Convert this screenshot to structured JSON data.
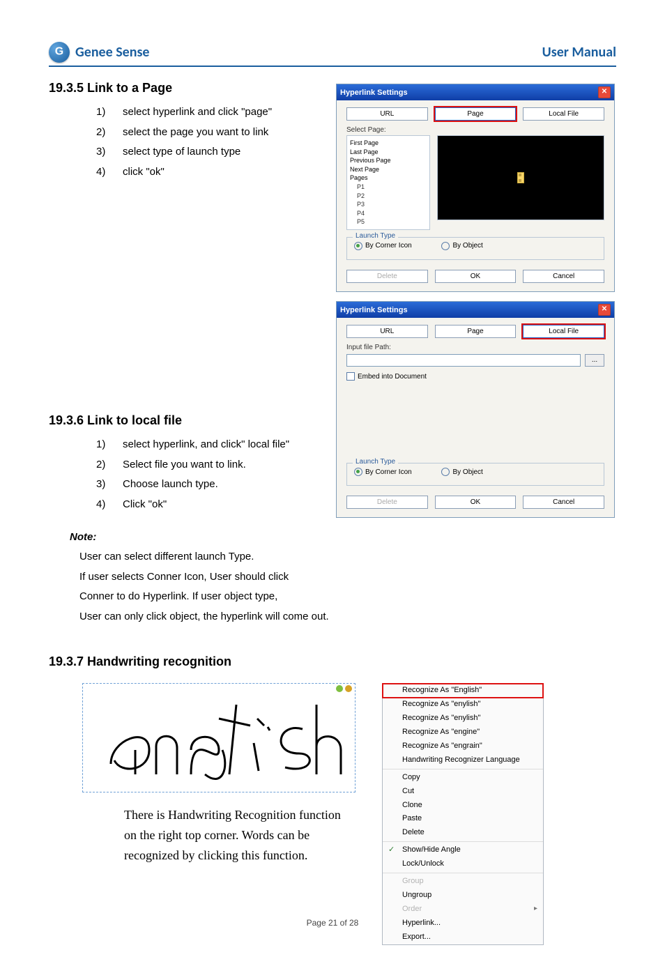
{
  "header": {
    "brand": "Genee Sense",
    "doc_title": "User Manual"
  },
  "footer": "Page 21 of 28",
  "s1935": {
    "heading": "19.3.5  Link to a Page",
    "items": [
      {
        "n": "1)",
        "t": "select  hyperlink and click \"page\""
      },
      {
        "n": "2)",
        "t": "select the page you want to link"
      },
      {
        "n": "3)",
        "t": "select type of launch type"
      },
      {
        "n": "4)",
        "t": "click \"ok\""
      }
    ]
  },
  "s1936": {
    "heading": "19.3.6  Link to local file",
    "items": [
      {
        "n": "1)",
        "t": "select hyperlink, and click\" local file\""
      },
      {
        "n": "2)",
        "t": "Select file you want to link."
      },
      {
        "n": "3)",
        "t": "Choose launch type."
      },
      {
        "n": "4)",
        "t": "Click \"ok\""
      }
    ]
  },
  "note": {
    "head": "Note:",
    "lines": [
      "User can select different launch Type.",
      "If user selects Conner Icon, User should click",
      "Conner to do Hyperlink.  If user  object type,",
      "User can only click object, the hyperlink will come out."
    ]
  },
  "s1937": {
    "heading": "19.3.7 Handwriting recognition",
    "caption": [
      "There is Handwriting Recognition function",
      "on the right top corner. Words can be",
      "recognized by clicking this function."
    ]
  },
  "dlg_page": {
    "title": "Hyperlink Settings",
    "tabs": {
      "url": "URL",
      "page": "Page",
      "local": "Local File",
      "selected": "page"
    },
    "select_page_label": "Select Page:",
    "tree": [
      "First Page",
      "Last Page",
      "Previous Page",
      "Next Page",
      "Pages"
    ],
    "tree_children": [
      "P1",
      "P2",
      "P3",
      "P4",
      "P5"
    ],
    "launch_legend": "Launch Type",
    "radio_corner": "By Corner Icon",
    "radio_object": "By Object",
    "radio_selected": "corner",
    "btn_delete": "Delete",
    "btn_ok": "OK",
    "btn_cancel": "Cancel"
  },
  "dlg_local": {
    "title": "Hyperlink Settings",
    "tabs": {
      "url": "URL",
      "page": "Page",
      "local": "Local File",
      "selected": "local"
    },
    "path_label": "Input file Path:",
    "browse": "...",
    "embed": "Embed into Document",
    "launch_legend": "Launch Type",
    "radio_corner": "By Corner Icon",
    "radio_object": "By Object",
    "radio_selected": "corner",
    "btn_delete": "Delete",
    "btn_ok": "OK",
    "btn_cancel": "Cancel"
  },
  "context_menu": {
    "top": "Recognize As \"English\"",
    "items": [
      "Recognize As \"enylish\"",
      "Recognize As \"enylish\"",
      "Recognize As \"engine\"",
      "Recognize As \"engrain\"",
      "Handwriting Recognizer Language"
    ],
    "edit": [
      "Copy",
      "Cut",
      "Clone",
      "Paste",
      "Delete"
    ],
    "view": [
      {
        "t": "Show/Hide Angle",
        "tick": true
      },
      {
        "t": "Lock/Unlock"
      }
    ],
    "group": [
      {
        "t": "Group",
        "disabled": true
      },
      {
        "t": "Ungroup"
      },
      {
        "t": "Order",
        "disabled": true,
        "arrow": true
      },
      {
        "t": "Hyperlink..."
      },
      {
        "t": "Export..."
      }
    ]
  }
}
